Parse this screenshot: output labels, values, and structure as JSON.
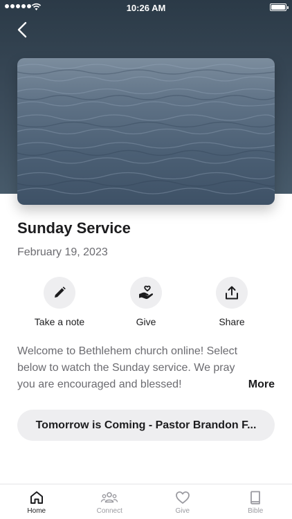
{
  "status_bar": {
    "time": "10:26 AM"
  },
  "event": {
    "title": "Sunday Service",
    "date": "February 19, 2023",
    "description": "Welcome to Bethlehem church online! Select below to watch the Sunday service. We pray you are encouraged and blessed!",
    "more_label": "More",
    "sermon_label": "Tomorrow is Coming - Pastor Brandon F..."
  },
  "actions": [
    {
      "label": "Take a note",
      "icon": "pencil-icon"
    },
    {
      "label": "Give",
      "icon": "heart-hand-icon"
    },
    {
      "label": "Share",
      "icon": "share-icon"
    }
  ],
  "tabs": [
    {
      "label": "Home",
      "icon": "home-icon",
      "active": true
    },
    {
      "label": "Connect",
      "icon": "people-icon",
      "active": false
    },
    {
      "label": "Give",
      "icon": "heart-icon",
      "active": false
    },
    {
      "label": "Bible",
      "icon": "book-icon",
      "active": false
    }
  ],
  "colors": {
    "header": "#2b3a47",
    "text": "#1c1c1e",
    "secondary_text": "#6b6b70",
    "pill_background": "#eeeef0"
  }
}
